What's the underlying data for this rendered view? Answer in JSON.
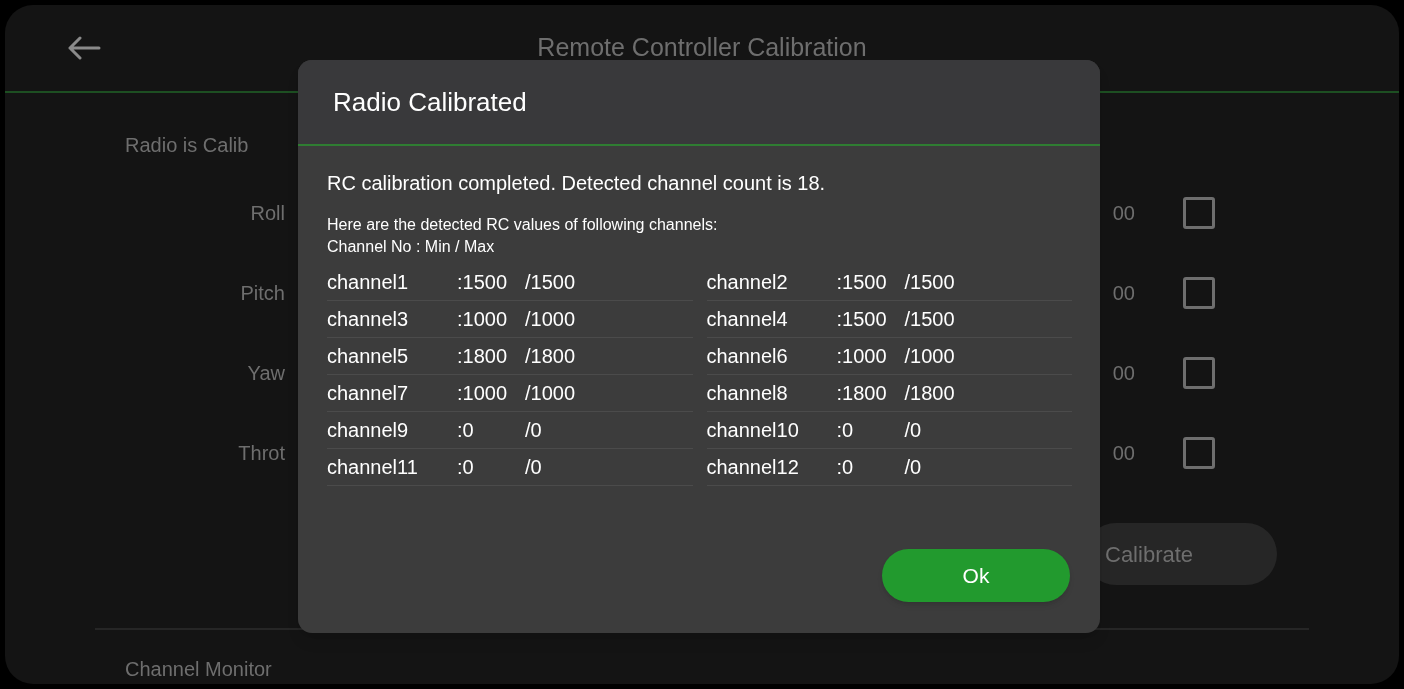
{
  "header": {
    "title": "Remote Controller Calibration"
  },
  "status": "Radio is Calib",
  "axes": [
    {
      "label": "Roll",
      "value": "00",
      "checked": false
    },
    {
      "label": "Pitch",
      "value": "00",
      "checked": false
    },
    {
      "label": "Yaw",
      "value": "00",
      "checked": false
    },
    {
      "label": "Throt",
      "value": "00",
      "checked": false
    }
  ],
  "calibrate_button": "Calibrate",
  "monitor_title": "Channel Monitor",
  "dialog": {
    "title": "Radio Calibrated",
    "message": "RC calibration completed. Detected channel count is 18.",
    "hint_lines": [
      "Here are the detected RC values of following channels:",
      "Channel No : Min / Max"
    ],
    "channels": [
      {
        "name": "channel1",
        "min": ":1500",
        "max": "/1500"
      },
      {
        "name": "channel2",
        "min": ":1500",
        "max": "/1500"
      },
      {
        "name": "channel3",
        "min": ":1000",
        "max": "/1000"
      },
      {
        "name": "channel4",
        "min": ":1500",
        "max": "/1500"
      },
      {
        "name": "channel5",
        "min": ":1800",
        "max": "/1800"
      },
      {
        "name": "channel6",
        "min": ":1000",
        "max": "/1000"
      },
      {
        "name": "channel7",
        "min": ":1000",
        "max": "/1000"
      },
      {
        "name": "channel8",
        "min": ":1800",
        "max": "/1800"
      },
      {
        "name": "channel9",
        "min": ":0",
        "max": "/0"
      },
      {
        "name": "channel10",
        "min": ":0",
        "max": "/0"
      },
      {
        "name": "channel11",
        "min": ":0",
        "max": "/0"
      },
      {
        "name": "channel12",
        "min": ":0",
        "max": "/0"
      }
    ],
    "ok_button": "Ok"
  }
}
